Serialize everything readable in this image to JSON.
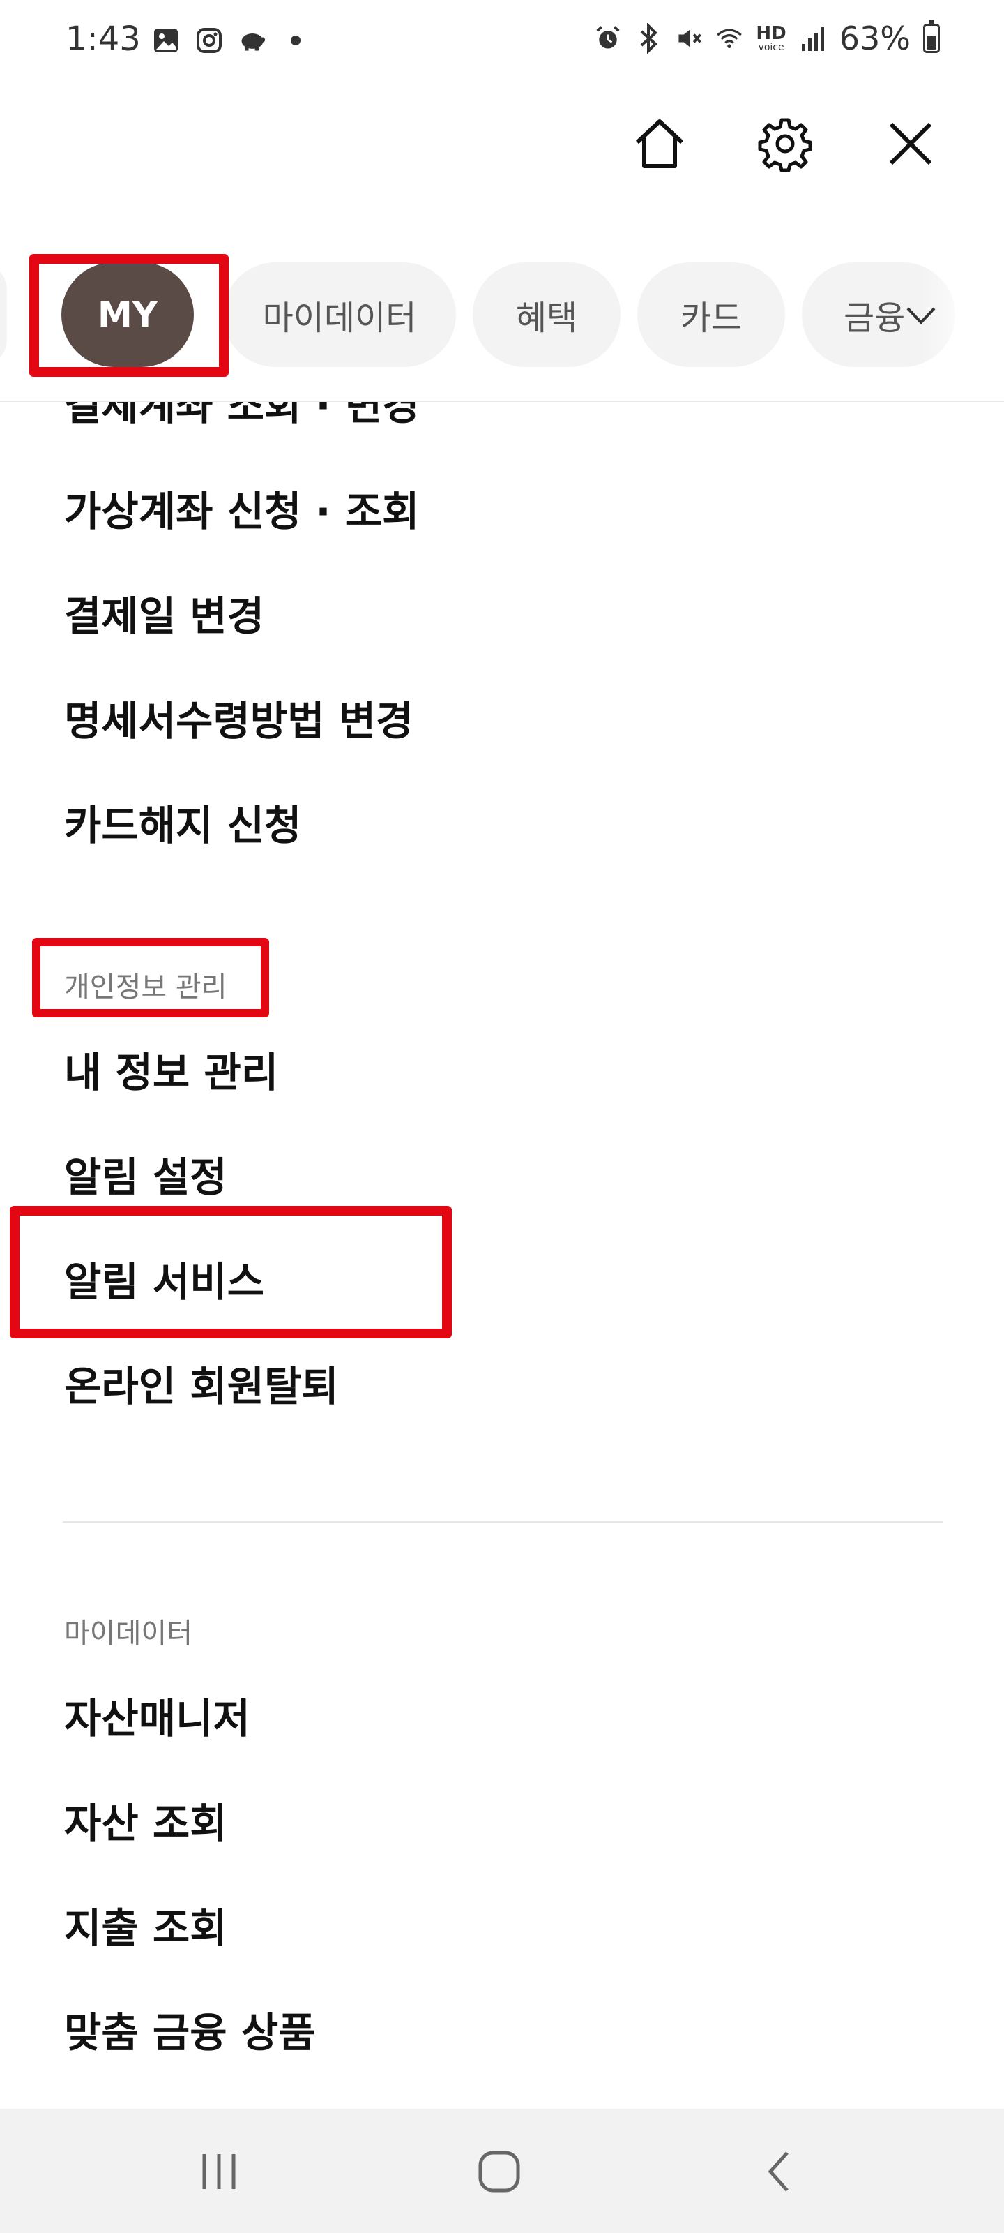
{
  "status_bar": {
    "time": "1:43",
    "battery": "63%",
    "hd_label": "HD",
    "voice_label": "voice"
  },
  "header": {
    "home_icon": "home-icon",
    "settings_icon": "gear-icon",
    "close_icon": "close-icon"
  },
  "tabs": [
    {
      "label": "MY",
      "selected": true
    },
    {
      "label": "마이데이터"
    },
    {
      "label": "혜택"
    },
    {
      "label": "카드"
    },
    {
      "label": "금융"
    }
  ],
  "clipped_item": "결제계좌 조회 · 변경",
  "menu_group1": [
    "가상계좌 신청 · 조회",
    "결제일 변경",
    "명세서수령방법 변경",
    "카드해지 신청"
  ],
  "section_personal": {
    "label": "개인정보 관리",
    "items": [
      "내 정보 관리",
      "알림 설정",
      "알림 서비스",
      "온라인 회원탈퇴"
    ]
  },
  "section_mydata": {
    "label": "마이데이터",
    "items": [
      "자산매니저",
      "자산 조회",
      "지출 조회",
      "맞춤 금융 상품"
    ]
  },
  "colors": {
    "accent_tab": "#5a4b46",
    "highlight": "#e30613"
  }
}
